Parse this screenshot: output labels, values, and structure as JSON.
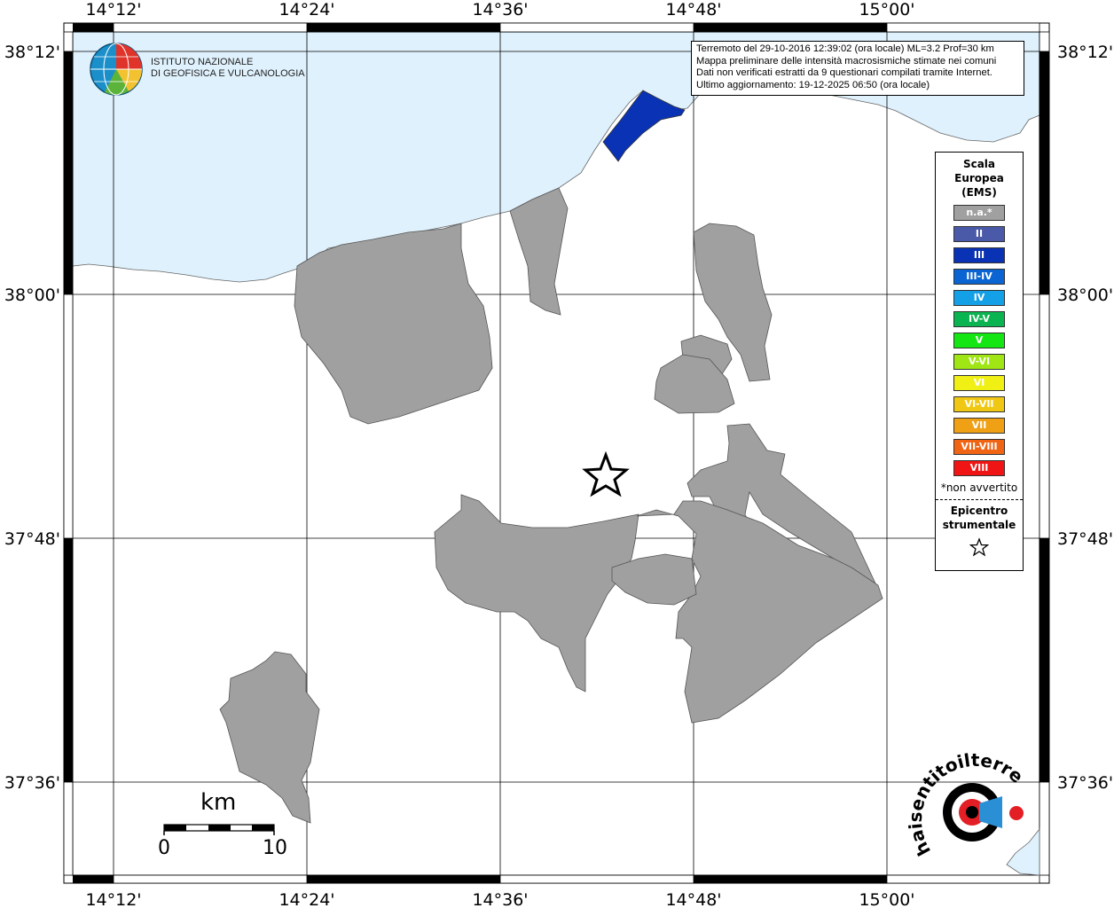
{
  "map": {
    "lon_ticks": [
      "14°12'",
      "14°24'",
      "14°36'",
      "14°48'",
      "15°00'"
    ],
    "lat_ticks": [
      "38°12'",
      "38°00'",
      "37°48'",
      "37°36'"
    ]
  },
  "logo": {
    "line1": "ISTITUTO NAZIONALE",
    "line2": "DI GEOFISICA E VULCANOLOGIA"
  },
  "info": {
    "line1": "Terremoto del 29-10-2016 12:39:02 (ora locale) ML=3.2 Prof=30 km",
    "line2": "Mappa preliminare delle intensità macrosismiche stimate nei comuni",
    "line3": "Dati non verificati estratti da 9 questionari compilati tramite Internet.",
    "line4": "Ultimo aggiornamento: 19-12-2025 06:50 (ora locale)"
  },
  "legend": {
    "title1": "Scala",
    "title2": "Europea",
    "title3": "(EMS)",
    "items": [
      {
        "label": "n.a.*",
        "color": "#a0a0a0"
      },
      {
        "label": "II",
        "color": "#4a5aa8"
      },
      {
        "label": "III",
        "color": "#0a32b4"
      },
      {
        "label": "III-IV",
        "color": "#0a64d2"
      },
      {
        "label": "IV",
        "color": "#14a0e6"
      },
      {
        "label": "IV-V",
        "color": "#0ab450"
      },
      {
        "label": "V",
        "color": "#14e614"
      },
      {
        "label": "V-VI",
        "color": "#a0e614"
      },
      {
        "label": "VI",
        "color": "#f0f014"
      },
      {
        "label": "VI-VII",
        "color": "#f0c814"
      },
      {
        "label": "VII",
        "color": "#f0a014"
      },
      {
        "label": "VII-VIII",
        "color": "#f06414"
      },
      {
        "label": "VIII",
        "color": "#f01414"
      }
    ],
    "note": "*non avvertito",
    "epicentre1": "Epicentro",
    "epicentre2": "strumentale"
  },
  "scale": {
    "unit": "km",
    "min_label": "0",
    "max_label": "10"
  },
  "watermark": {
    "text": "haisentitoilterremoto.it"
  },
  "colors": {
    "sea": "#dff1fc",
    "na_fill": "#a0a0a0",
    "intensity_III": "#0a32b4"
  }
}
